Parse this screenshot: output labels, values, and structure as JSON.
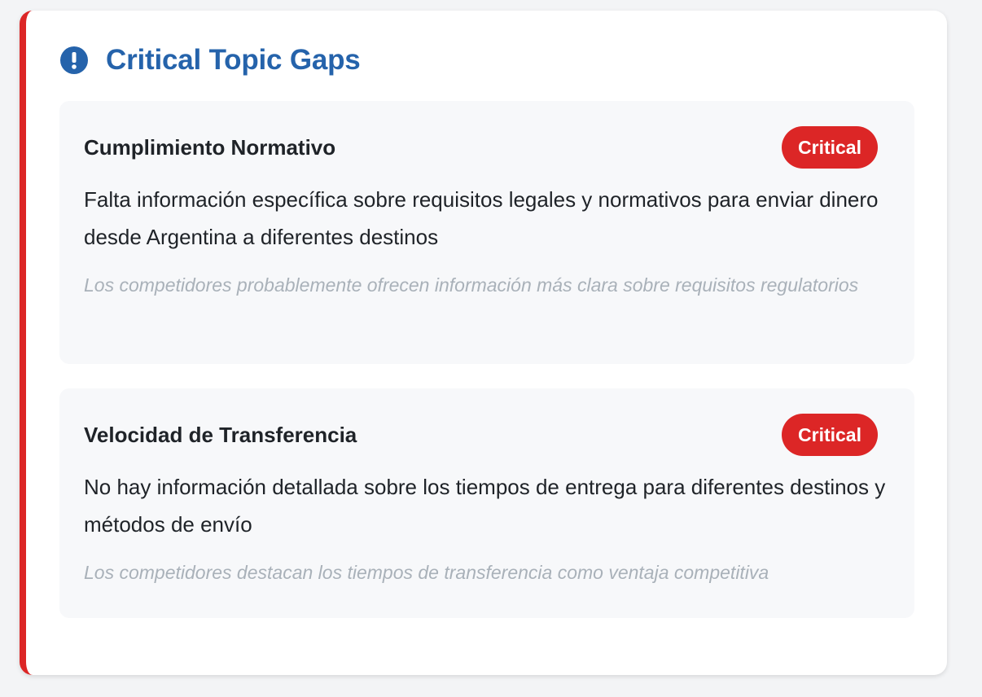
{
  "section": {
    "title": "Critical Topic Gaps",
    "icon": "exclamation-circle-icon",
    "accent_color": "#dc2626",
    "title_color": "#2563ab"
  },
  "gaps": [
    {
      "title": "Cumplimiento Normativo",
      "badge": "Critical",
      "description": "Falta información específica sobre requisitos legales y normativos para enviar dinero desde Argentina a diferentes destinos",
      "note": "Los competidores probablemente ofrecen información más clara sobre requisitos regulatorios"
    },
    {
      "title": "Velocidad de Transferencia",
      "badge": "Critical",
      "description": "No hay información detallada sobre los tiempos de entrega para diferentes destinos y métodos de envío",
      "note": "Los competidores destacan los tiempos de transferencia como ventaja competitiva"
    }
  ]
}
